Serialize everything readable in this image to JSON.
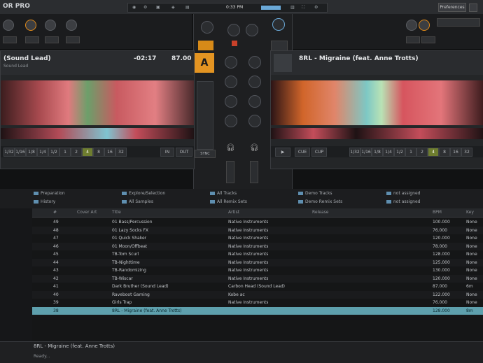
{
  "app": {
    "title": "OR PRO"
  },
  "statusbar": {
    "time": "0:33 PM",
    "pref": "Preferences"
  },
  "deck_a": {
    "title": "(Sound Lead)",
    "artist": "Sound Lead",
    "time": "-02:17",
    "bpm": "87.00",
    "loop_sizes": [
      "1/32",
      "1/16",
      "1/8",
      "1/4",
      "1/2",
      "1",
      "2",
      "4",
      "8",
      "16",
      "32"
    ],
    "in_label": "IN",
    "out_label": "OUT",
    "sync": "SYNC",
    "active_letter": "A"
  },
  "deck_b": {
    "title": "8RL - Migraine (feat. Anne Trotts)",
    "loop_sizes": [
      "1/32",
      "1/16",
      "1/8",
      "1/4",
      "1/2",
      "1",
      "2",
      "4",
      "8",
      "16",
      "32"
    ],
    "cue": "CUE",
    "cup": "CUP",
    "play": "▶"
  },
  "browser": {
    "favorites": [
      "Preparation",
      "History",
      "Explore/Selection",
      "All Samples",
      "All Tracks",
      "All Remix Sets",
      "Demo Tracks",
      "Demo Remix Sets",
      "not assigned",
      "not assigned"
    ],
    "columns": [
      "#",
      "Cover Art",
      "Title",
      "Artist",
      "Release",
      "BPM",
      "Key"
    ],
    "rows": [
      {
        "n": "49",
        "title": "01 Bass/Percussion",
        "artist": "Native Instruments",
        "bpm": "100.000",
        "key": "None"
      },
      {
        "n": "48",
        "title": "01 Lazy Socks FX",
        "artist": "Native Instruments",
        "bpm": "76.000",
        "key": "None"
      },
      {
        "n": "47",
        "title": "01 Quick Shaker",
        "artist": "Native Instruments",
        "bpm": "120.000",
        "key": "None"
      },
      {
        "n": "46",
        "title": "01 Moon/Offbeat",
        "artist": "Native Instruments",
        "bpm": "78.000",
        "key": "None"
      },
      {
        "n": "45",
        "title": "TB-Tom Scurl",
        "artist": "Native Instruments",
        "bpm": "128.000",
        "key": "None"
      },
      {
        "n": "44",
        "title": "TB-Nighttime",
        "artist": "Native Instruments",
        "bpm": "125.000",
        "key": "None"
      },
      {
        "n": "43",
        "title": "TB-Randomizing",
        "artist": "Native Instruments",
        "bpm": "130.000",
        "key": "None"
      },
      {
        "n": "42",
        "title": "TB-Wiscar",
        "artist": "Native Instruments",
        "bpm": "120.000",
        "key": "None"
      },
      {
        "n": "41",
        "title": "Dark Bruther (Sound Lead)",
        "artist": "Carbon Head (Sound Lead)",
        "bpm": "87.000",
        "key": "6m"
      },
      {
        "n": "40",
        "title": "Raveboot Gaming",
        "artist": "Kobe ac",
        "bpm": "122.000",
        "key": "None"
      },
      {
        "n": "39",
        "title": "Girls Trap",
        "artist": "Native Instruments",
        "bpm": "76.000",
        "key": "None"
      },
      {
        "n": "38",
        "title": "8RL - Migraine (feat. Anne Trotts)",
        "artist": "",
        "bpm": "128.000",
        "key": "8m"
      }
    ],
    "selected_index": 11
  },
  "footer": {
    "now_playing": "8RL - Migraine (feat. Anne Trotts)",
    "ready": "Ready..."
  }
}
